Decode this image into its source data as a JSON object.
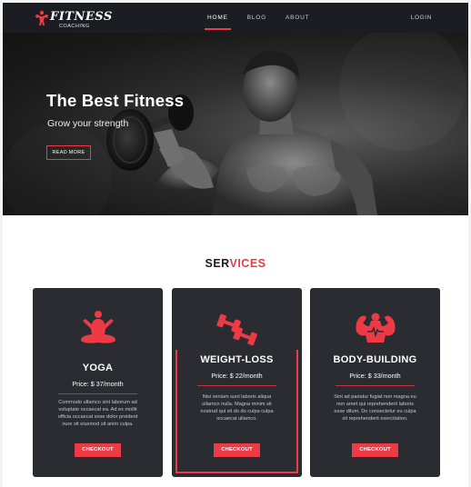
{
  "nav": {
    "brand": "FITNESS",
    "brand_sub": "COACHING",
    "links": [
      "HOME",
      "BLOG",
      "ABOUT"
    ],
    "active": "HOME",
    "login": "LOGIN"
  },
  "hero": {
    "title": "The Best Fitness",
    "subtitle": "Grow your strength",
    "button": "READ MORE"
  },
  "services": {
    "title_dark": "SER",
    "title_red": "VICES",
    "cards": [
      {
        "icon": "yoga-icon",
        "name": "YOGA",
        "price": "Price: $ 37/month",
        "desc": "Commodo ullamco sint laborum ad voluptate occaecat ea. Ad ex mollit officia occaecat esse dolor proident irure sit eiusmod sit anim culpa.",
        "button": "CHECKOUT"
      },
      {
        "icon": "dumbbell-icon",
        "name": "WEIGHT-LOSS",
        "price": "Price: $ 22/month",
        "desc": "Nisi veniam sunt laboris aliqua ullamco nulla. Magna minim sit nostrud qui sit do do culpa culpa occaecat ullamco.",
        "button": "CHECKOUT"
      },
      {
        "icon": "bodybuilding-icon",
        "name": "BODY-BUILDING",
        "price": "Price: $ 33/month",
        "desc": "Sint ad pariatur fugiat non magna eu non amet qui reprehenderit laboris esse dilum. Do consectetur eu culpa sit reprehenderit exercitation.",
        "button": "CHECKOUT"
      }
    ]
  },
  "colors": {
    "accent": "#ee3a45",
    "nav_bg": "#1c1d22",
    "card_bg": "#2b2c32"
  }
}
